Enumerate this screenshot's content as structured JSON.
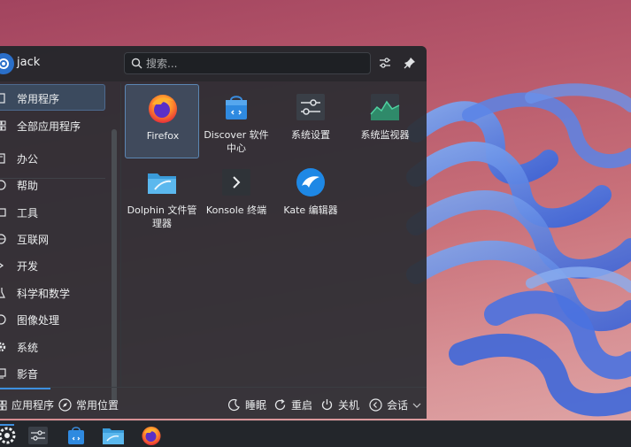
{
  "user": {
    "name": "jack"
  },
  "search": {
    "placeholder": "搜索..."
  },
  "header_icons": [
    "configure-icon",
    "pin-icon"
  ],
  "sidebar": {
    "items": [
      {
        "label": "常用程序",
        "icon": "star-icon",
        "active": true
      },
      {
        "label": "全部应用程序",
        "icon": "grid-icon"
      },
      {
        "label": "办公",
        "icon": "office-icon"
      },
      {
        "label": "帮助",
        "icon": "help-icon"
      },
      {
        "label": "工具",
        "icon": "tools-icon"
      },
      {
        "label": "互联网",
        "icon": "globe-icon"
      },
      {
        "label": "开发",
        "icon": "code-icon"
      },
      {
        "label": "科学和数学",
        "icon": "flask-icon"
      },
      {
        "label": "图像处理",
        "icon": "image-icon"
      },
      {
        "label": "系统",
        "icon": "gear-icon"
      },
      {
        "label": "影音",
        "icon": "media-icon"
      }
    ]
  },
  "apps": [
    {
      "label": "Firefox",
      "icon": "firefox-icon",
      "selected": true
    },
    {
      "label": "Discover 软件中心",
      "icon": "discover-icon"
    },
    {
      "label": "系统设置",
      "icon": "settings-icon"
    },
    {
      "label": "系统监视器",
      "icon": "monitor-icon"
    },
    {
      "label": "Dolphin 文件管理器",
      "icon": "folder-icon"
    },
    {
      "label": "Konsole 终端",
      "icon": "terminal-icon"
    },
    {
      "label": "Kate 编辑器",
      "icon": "kate-icon"
    }
  ],
  "footer": {
    "tabs": [
      {
        "label": "应用程序",
        "icon": "apps-grid-icon",
        "active": true
      },
      {
        "label": "常用位置",
        "icon": "compass-icon"
      }
    ],
    "actions": [
      {
        "label": "睡眠",
        "icon": "sleep-icon"
      },
      {
        "label": "重启",
        "icon": "restart-icon"
      },
      {
        "label": "关机",
        "icon": "power-icon"
      },
      {
        "label": "会话",
        "icon": "session-icon"
      }
    ]
  },
  "taskbar": [
    "kde-launcher-icon",
    "settings-icon",
    "discover-icon",
    "folder-icon",
    "firefox-icon"
  ],
  "colors": {
    "accent": "#3d8fe0",
    "panel": "#2a2c32",
    "selection": "#48607c"
  }
}
